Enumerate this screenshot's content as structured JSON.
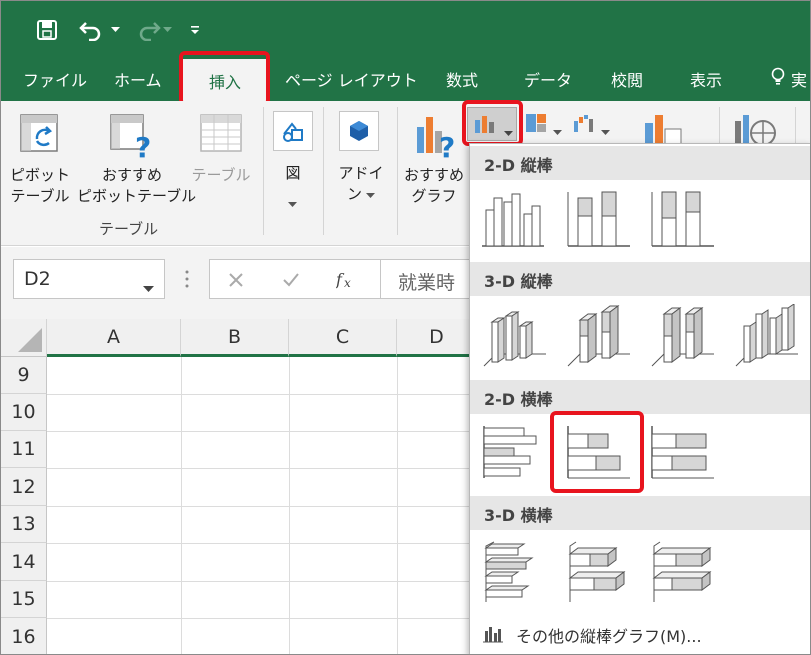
{
  "tabs": {
    "file": "ファイル",
    "home": "ホーム",
    "insert": "挿入",
    "page_layout": "ページ レイアウト",
    "formulas": "数式",
    "data": "データ",
    "review": "校閲",
    "view": "表示",
    "tell_me": "実"
  },
  "ribbon": {
    "pivot_table": [
      "ピボット",
      "テーブル"
    ],
    "recommended_pivot": [
      "おすすめ",
      "ピボットテーブル"
    ],
    "table": "テーブル",
    "tables_group": "テーブル",
    "illustrations": "図",
    "addins": [
      "アドイ",
      "ン"
    ],
    "recommended_charts": [
      "おすすめ",
      "グラフ"
    ]
  },
  "formula_bar": {
    "name_box": "D2",
    "content": "就業時"
  },
  "grid": {
    "columns": [
      "A",
      "B",
      "C",
      "D"
    ],
    "rows": [
      "9",
      "10",
      "11",
      "12",
      "13",
      "14",
      "15",
      "16"
    ]
  },
  "dropdown": {
    "sections": {
      "col_2d": "2-D 縦棒",
      "col_3d": "3-D 縦棒",
      "bar_2d": "2-D 横棒",
      "bar_3d": "3-D 横棒"
    },
    "footer": "その他の縦棒グラフ(M)..."
  },
  "highlight_color": "#e8141e",
  "accent_color": "#217346"
}
